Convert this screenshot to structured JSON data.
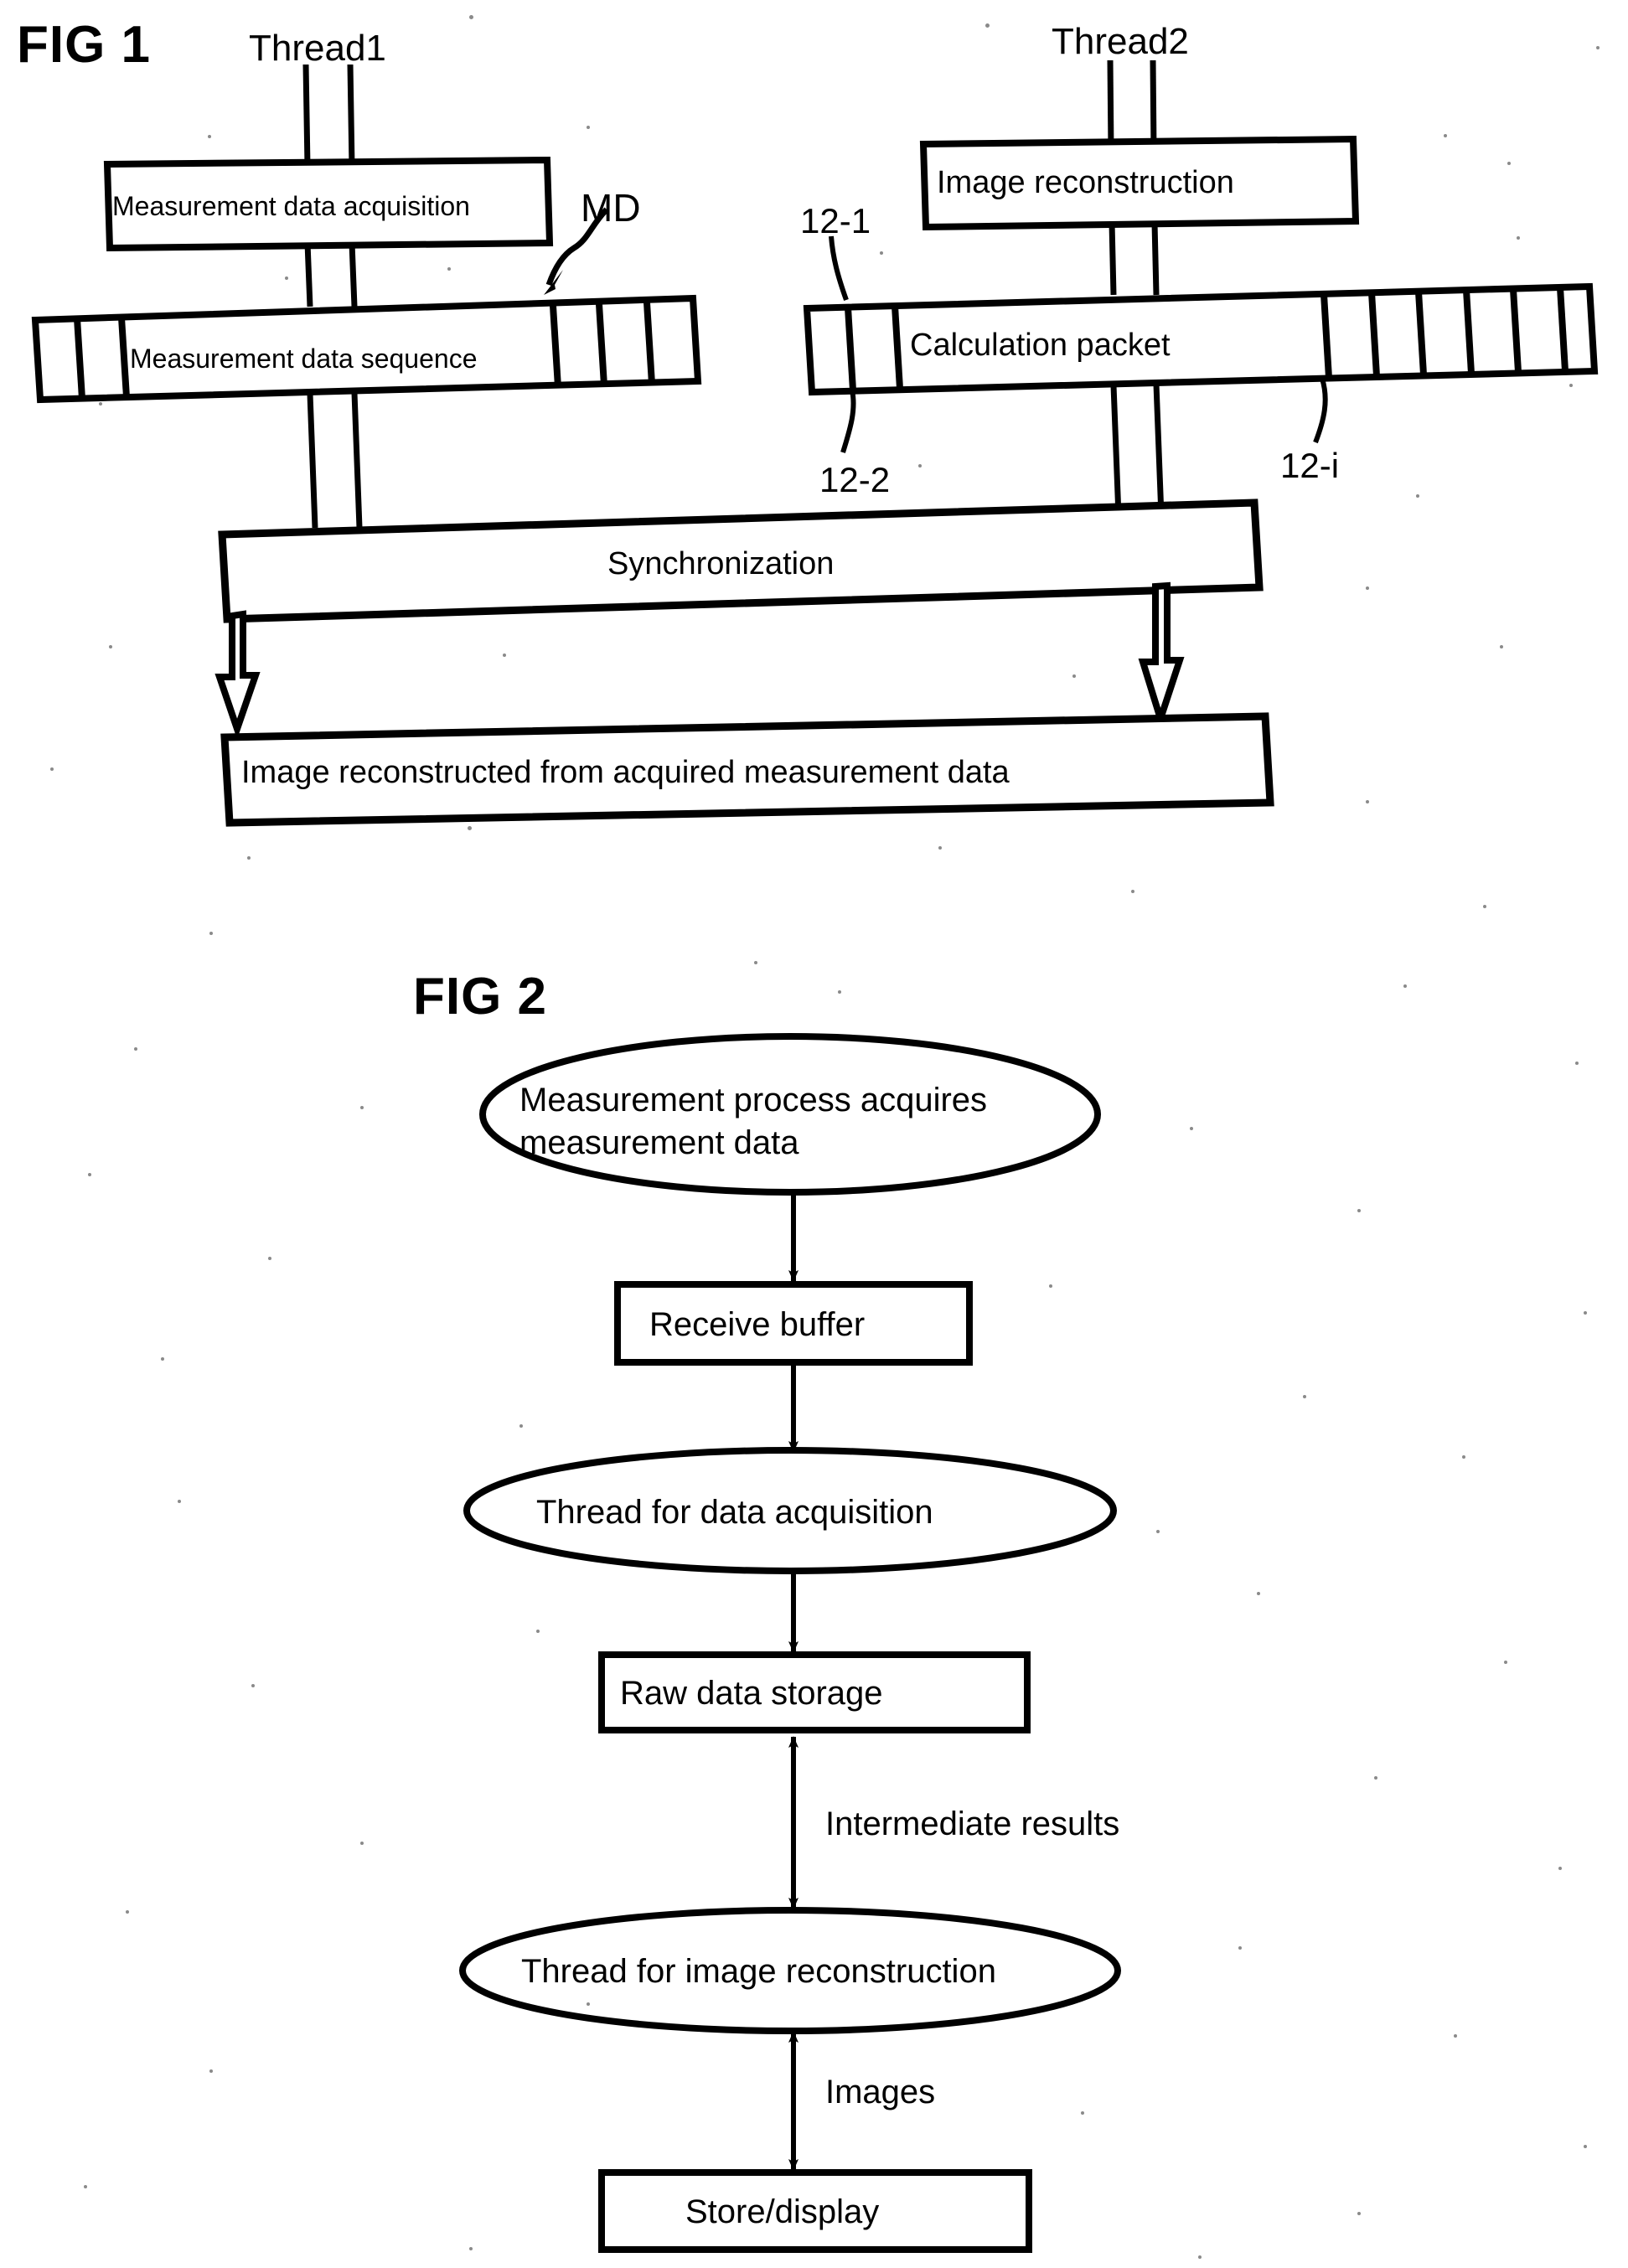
{
  "figures": [
    {
      "id": "fig1",
      "label": "FIG 1",
      "threads": [
        {
          "name": "thread1",
          "label": "Thread1"
        },
        {
          "name": "thread2",
          "label": "Thread2"
        }
      ],
      "boxes": {
        "measurement_data_acquisition": "Measurement data acquisition",
        "image_reconstruction": "Image reconstruction",
        "measurement_data_sequence": "Measurement data sequence",
        "calculation_packet": "Calculation packet",
        "synchronization": "Synchronization",
        "result": "Image reconstructed from acquired measurement data"
      },
      "callouts": {
        "md": "MD",
        "ref_12_1": "12-1",
        "ref_12_2": "12-2",
        "ref_12_i": "12-i"
      },
      "sequence_cells": {
        "left_count": 2,
        "right_count": 3
      },
      "packet_cells": {
        "left_count": 2,
        "right_count": 6
      }
    },
    {
      "id": "fig2",
      "label": "FIG 2",
      "nodes": [
        {
          "name": "measurement-process",
          "shape": "ellipse",
          "lines": [
            "Measurement process acquires",
            "measurement data"
          ]
        },
        {
          "name": "receive-buffer",
          "shape": "rect",
          "lines": [
            "Receive buffer"
          ]
        },
        {
          "name": "thread-data-acquisition",
          "shape": "ellipse",
          "lines": [
            "Thread for data acquisition"
          ]
        },
        {
          "name": "raw-data-storage",
          "shape": "rect",
          "lines": [
            "Raw data storage"
          ]
        },
        {
          "name": "thread-image-reconstruction",
          "shape": "ellipse",
          "lines": [
            "Thread for image reconstruction"
          ]
        },
        {
          "name": "store-display",
          "shape": "rect",
          "lines": [
            "Store/display"
          ]
        }
      ],
      "edges": [
        {
          "from": "measurement-process",
          "to": "receive-buffer",
          "label": "",
          "double": false
        },
        {
          "from": "receive-buffer",
          "to": "thread-data-acquisition",
          "label": "",
          "double": false
        },
        {
          "from": "thread-data-acquisition",
          "to": "raw-data-storage",
          "label": "",
          "double": false
        },
        {
          "from": "raw-data-storage",
          "to": "thread-image-reconstruction",
          "label": "Intermediate results",
          "double": true
        },
        {
          "from": "thread-image-reconstruction",
          "to": "store-display",
          "label": "Images",
          "double": true
        }
      ]
    }
  ],
  "colors": {
    "ink": "#000000",
    "paper": "#ffffff",
    "speckle": "#8a8a8a"
  }
}
